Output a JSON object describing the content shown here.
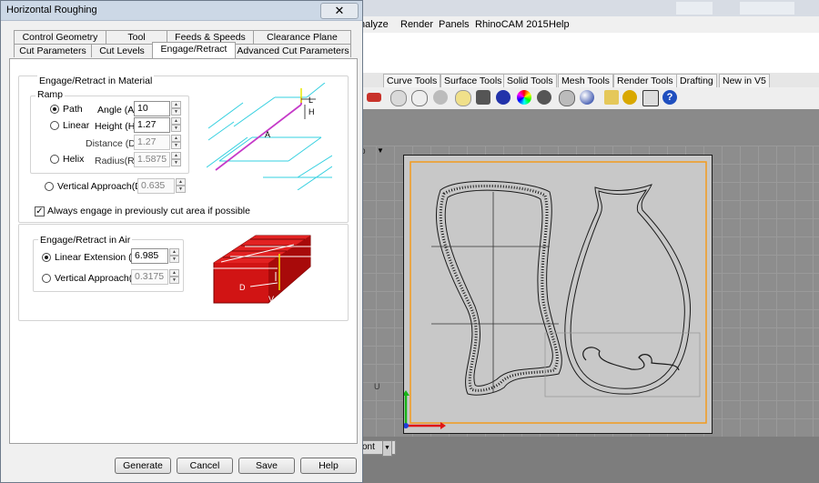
{
  "rhino": {
    "menu": [
      "nalyze",
      "Render",
      "Panels",
      "RhinoCAM 2015",
      "Help"
    ],
    "tabs": [
      "Curve Tools",
      "Surface Tools",
      "Solid Tools",
      "Mesh Tools",
      "Render Tools",
      "Drafting",
      "New in V5"
    ],
    "viewport_label": "p",
    "bottom_combo": "ont"
  },
  "dialog": {
    "title": "Horizontal Roughing",
    "close_label": "✕",
    "tabs_back": [
      "Control Geometry",
      "Tool",
      "Feeds & Speeds",
      "Clearance Plane"
    ],
    "tabs_front": [
      "Cut Parameters",
      "Cut Levels",
      "Engage/Retract",
      "Advanced Cut Parameters"
    ],
    "material": {
      "group_label": "Engage/Retract in Material",
      "ramp_label": "Ramp",
      "path_label": "Path",
      "linear_label": "Linear",
      "helix_label": "Helix",
      "angle_label": "Angle (A)",
      "angle_value": "10",
      "height_label": "Height (H)",
      "height_value": "1.27",
      "distance_label": "Distance (D)",
      "distance_value": "1.27",
      "radius_label": "Radius(R)",
      "radius_value": "1.5875",
      "vertical_label": "Vertical Approach(D)",
      "vertical_value": "0.635",
      "always_engage_label": "Always engage in previously cut area if possible"
    },
    "air": {
      "group_label": "Engage/Retract in Air",
      "linear_ext_label": "Linear Extension (D)",
      "linear_ext_value": "6.985",
      "vertical_label": "Vertical Approach(D)",
      "vertical_value": "0.3175"
    },
    "buttons": {
      "generate": "Generate",
      "cancel": "Cancel",
      "save": "Save",
      "help": "Help"
    },
    "diagram_labels": {
      "l": "L",
      "h": "H",
      "a": "A",
      "d": "D",
      "v": "V"
    }
  }
}
